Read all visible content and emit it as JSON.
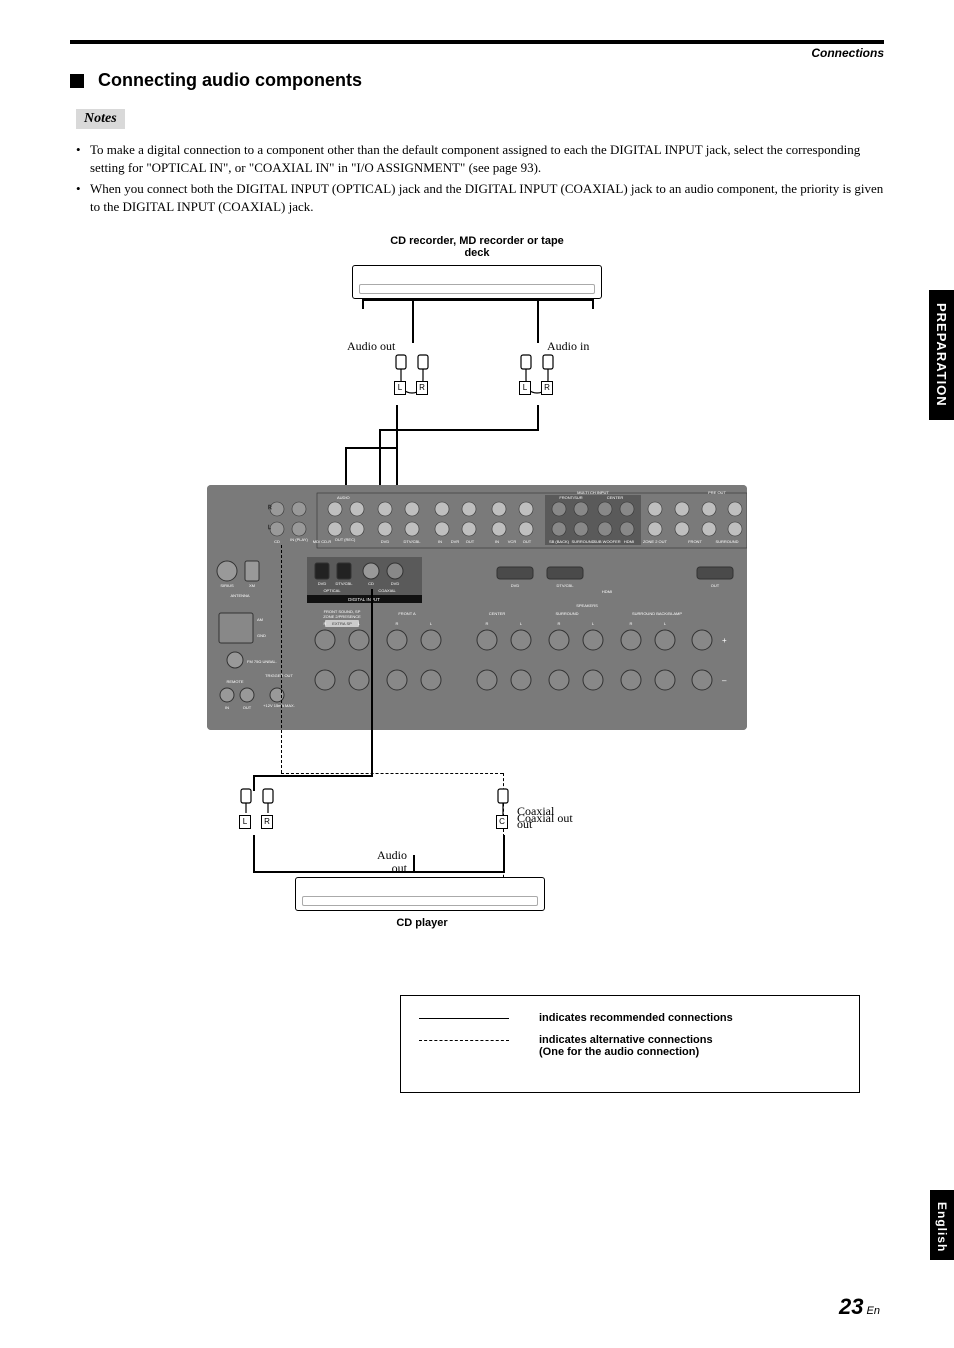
{
  "header": {
    "breadcrumb": "Connections",
    "section_title": "Connecting audio components",
    "notes_label": "Notes"
  },
  "notes": {
    "item1": "To make a digital connection to a component other than the default component assigned to each the DIGITAL INPUT jack, select the corresponding setting for \"OPTICAL IN\", or \"COAXIAL IN\" in \"I/O ASSIGNMENT\" (see page 93).",
    "item2": "When you connect both the DIGITAL INPUT (OPTICAL) jack and the DIGITAL INPUT (COAXIAL) jack to an audio component, the priority is given to the DIGITAL INPUT (COAXIAL) jack."
  },
  "diagram": {
    "top_device": "CD recorder, MD recorder or tape deck",
    "audio_out": "Audio out",
    "audio_in": "Audio in",
    "coaxial_out": "Coaxial out",
    "cd_player": "CD player",
    "L": "L",
    "R": "R",
    "C": "C",
    "panel": {
      "audio": "AUDIO",
      "cd": "CD",
      "in_play": "IN (PLAY)",
      "md_cdr": "MD/ CD-R",
      "out_rec": "OUT (REC)",
      "dvd": "DVD",
      "dtv_cbl": "DTV/CBL",
      "dvr_in": "IN",
      "dvr": "DVR",
      "dvr_out": "OUT",
      "vcr_in": "IN",
      "vcr": "VCR",
      "vcr_out": "OUT",
      "multi_ch": "MULTI CH INPUT",
      "front_sur": "FRONT/SUR",
      "center": "CENTER",
      "sb_back": "SB (BACK)",
      "surround": "SURROUND",
      "subwoofer": "SUB WOOFER",
      "zone2_out": "ZONE 2 OUT",
      "pre_out": "PRE OUT",
      "front": "FRONT",
      "surround2": "SURROUND",
      "sirius": "SIRIUS",
      "xm": "XM",
      "antenna": "ANTENNA",
      "optical": "OPTICAL",
      "coaxial": "COAXIAL",
      "digital_input": "DIGITAL INPUT",
      "hdmi": "HDMI",
      "out": "OUT",
      "am": "AM",
      "gnd": "GND",
      "fm": "FM 75Ω UNBAL.",
      "front_sound": "FRONT SOUND, SP",
      "zone2_presence": "ZONE 2/PRESENCE",
      "extra_sp": "EXTRA SP",
      "front_a": "FRONT A",
      "center2": "CENTER",
      "surround3": "SURROUND",
      "surround_back": "SURROUND BACK/BI-AMP",
      "speakers": "SPEAKERS",
      "remote": "REMOTE",
      "trigger": "TRIGGER OUT",
      "trigger_spec": "+12V 15mA MAX.",
      "remote_in": "IN",
      "remote_out": "OUT",
      "r_label": "R",
      "l_label": "L"
    }
  },
  "legend": {
    "rec": "indicates recommended connections",
    "alt1": "indicates alternative connections",
    "alt2": "(One for the audio connection)"
  },
  "sidetabs": {
    "preparation": "PREPARATION",
    "english": "English"
  },
  "page": {
    "num": "23",
    "suffix": "En"
  }
}
